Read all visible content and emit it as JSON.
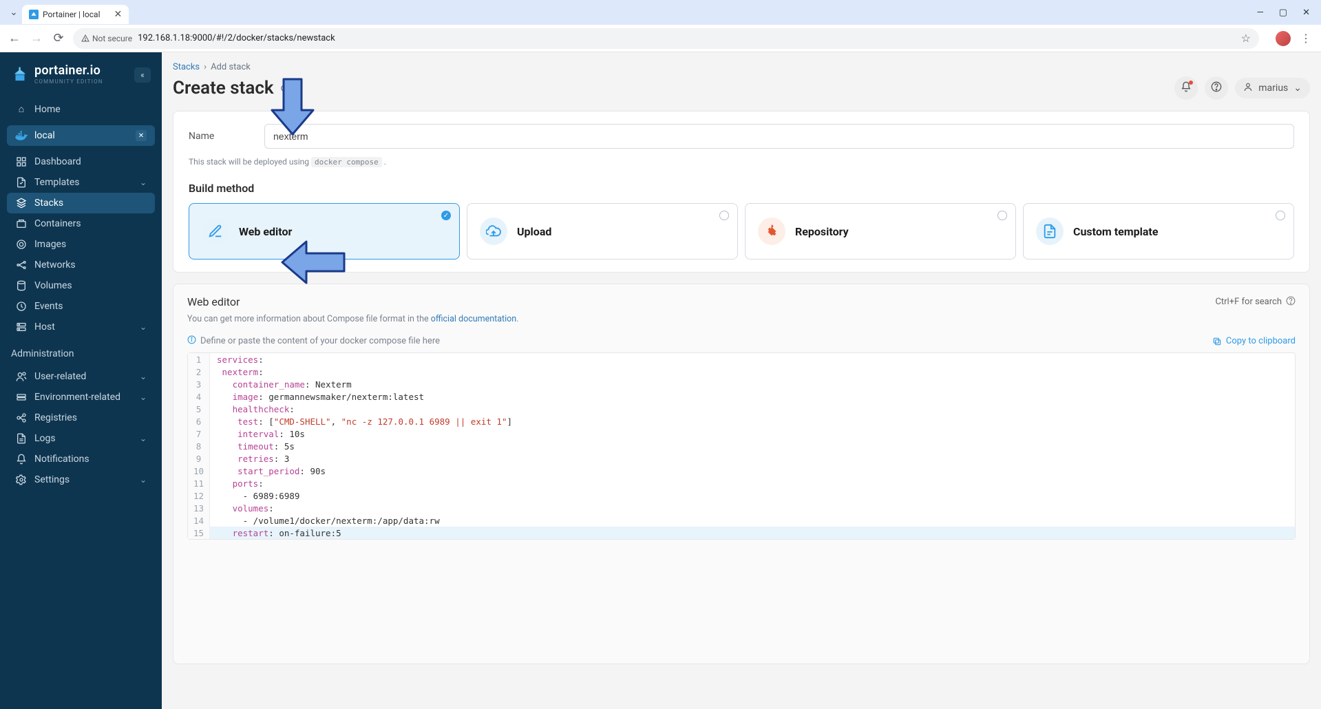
{
  "browser": {
    "tab_title": "Portainer | local",
    "not_secure": "Not secure",
    "url": "192.168.1.18:9000/#!/2/docker/stacks/newstack"
  },
  "sidebar": {
    "brand": "portainer.io",
    "edition": "COMMUNITY EDITION",
    "home": "Home",
    "env": "local",
    "items": [
      "Dashboard",
      "Templates",
      "Stacks",
      "Containers",
      "Images",
      "Networks",
      "Volumes",
      "Events",
      "Host"
    ],
    "admin_heading": "Administration",
    "admin_items": [
      "User-related",
      "Environment-related",
      "Registries",
      "Logs",
      "Notifications",
      "Settings"
    ]
  },
  "header": {
    "crumb_root": "Stacks",
    "crumb_leaf": "Add stack",
    "title": "Create stack",
    "user": "marius"
  },
  "form": {
    "name_label": "Name",
    "name_value": "nexterm",
    "hint_pre": "This stack will be deployed using",
    "hint_code": "docker compose",
    "build_heading": "Build method",
    "methods": [
      "Web editor",
      "Upload",
      "Repository",
      "Custom template"
    ]
  },
  "editor": {
    "title": "Web editor",
    "search_hint": "Ctrl+F for search",
    "sub_pre": "You can get more information about Compose file format in the ",
    "sub_link": "official documentation",
    "placeholder": "Define or paste the content of your docker compose file here",
    "copy": "Copy to clipboard",
    "lines": [
      "services:",
      " nexterm:",
      "   container_name: Nexterm",
      "   image: germannewsmaker/nexterm:latest",
      "   healthcheck:",
      "    test: [\"CMD-SHELL\", \"nc -z 127.0.0.1 6989 || exit 1\"]",
      "    interval: 10s",
      "    timeout: 5s",
      "    retries: 3",
      "    start_period: 90s",
      "   ports:",
      "     - 6989:6989",
      "   volumes:",
      "     - /volume1/docker/nexterm:/app/data:rw",
      "   restart: on-failure:5"
    ]
  }
}
